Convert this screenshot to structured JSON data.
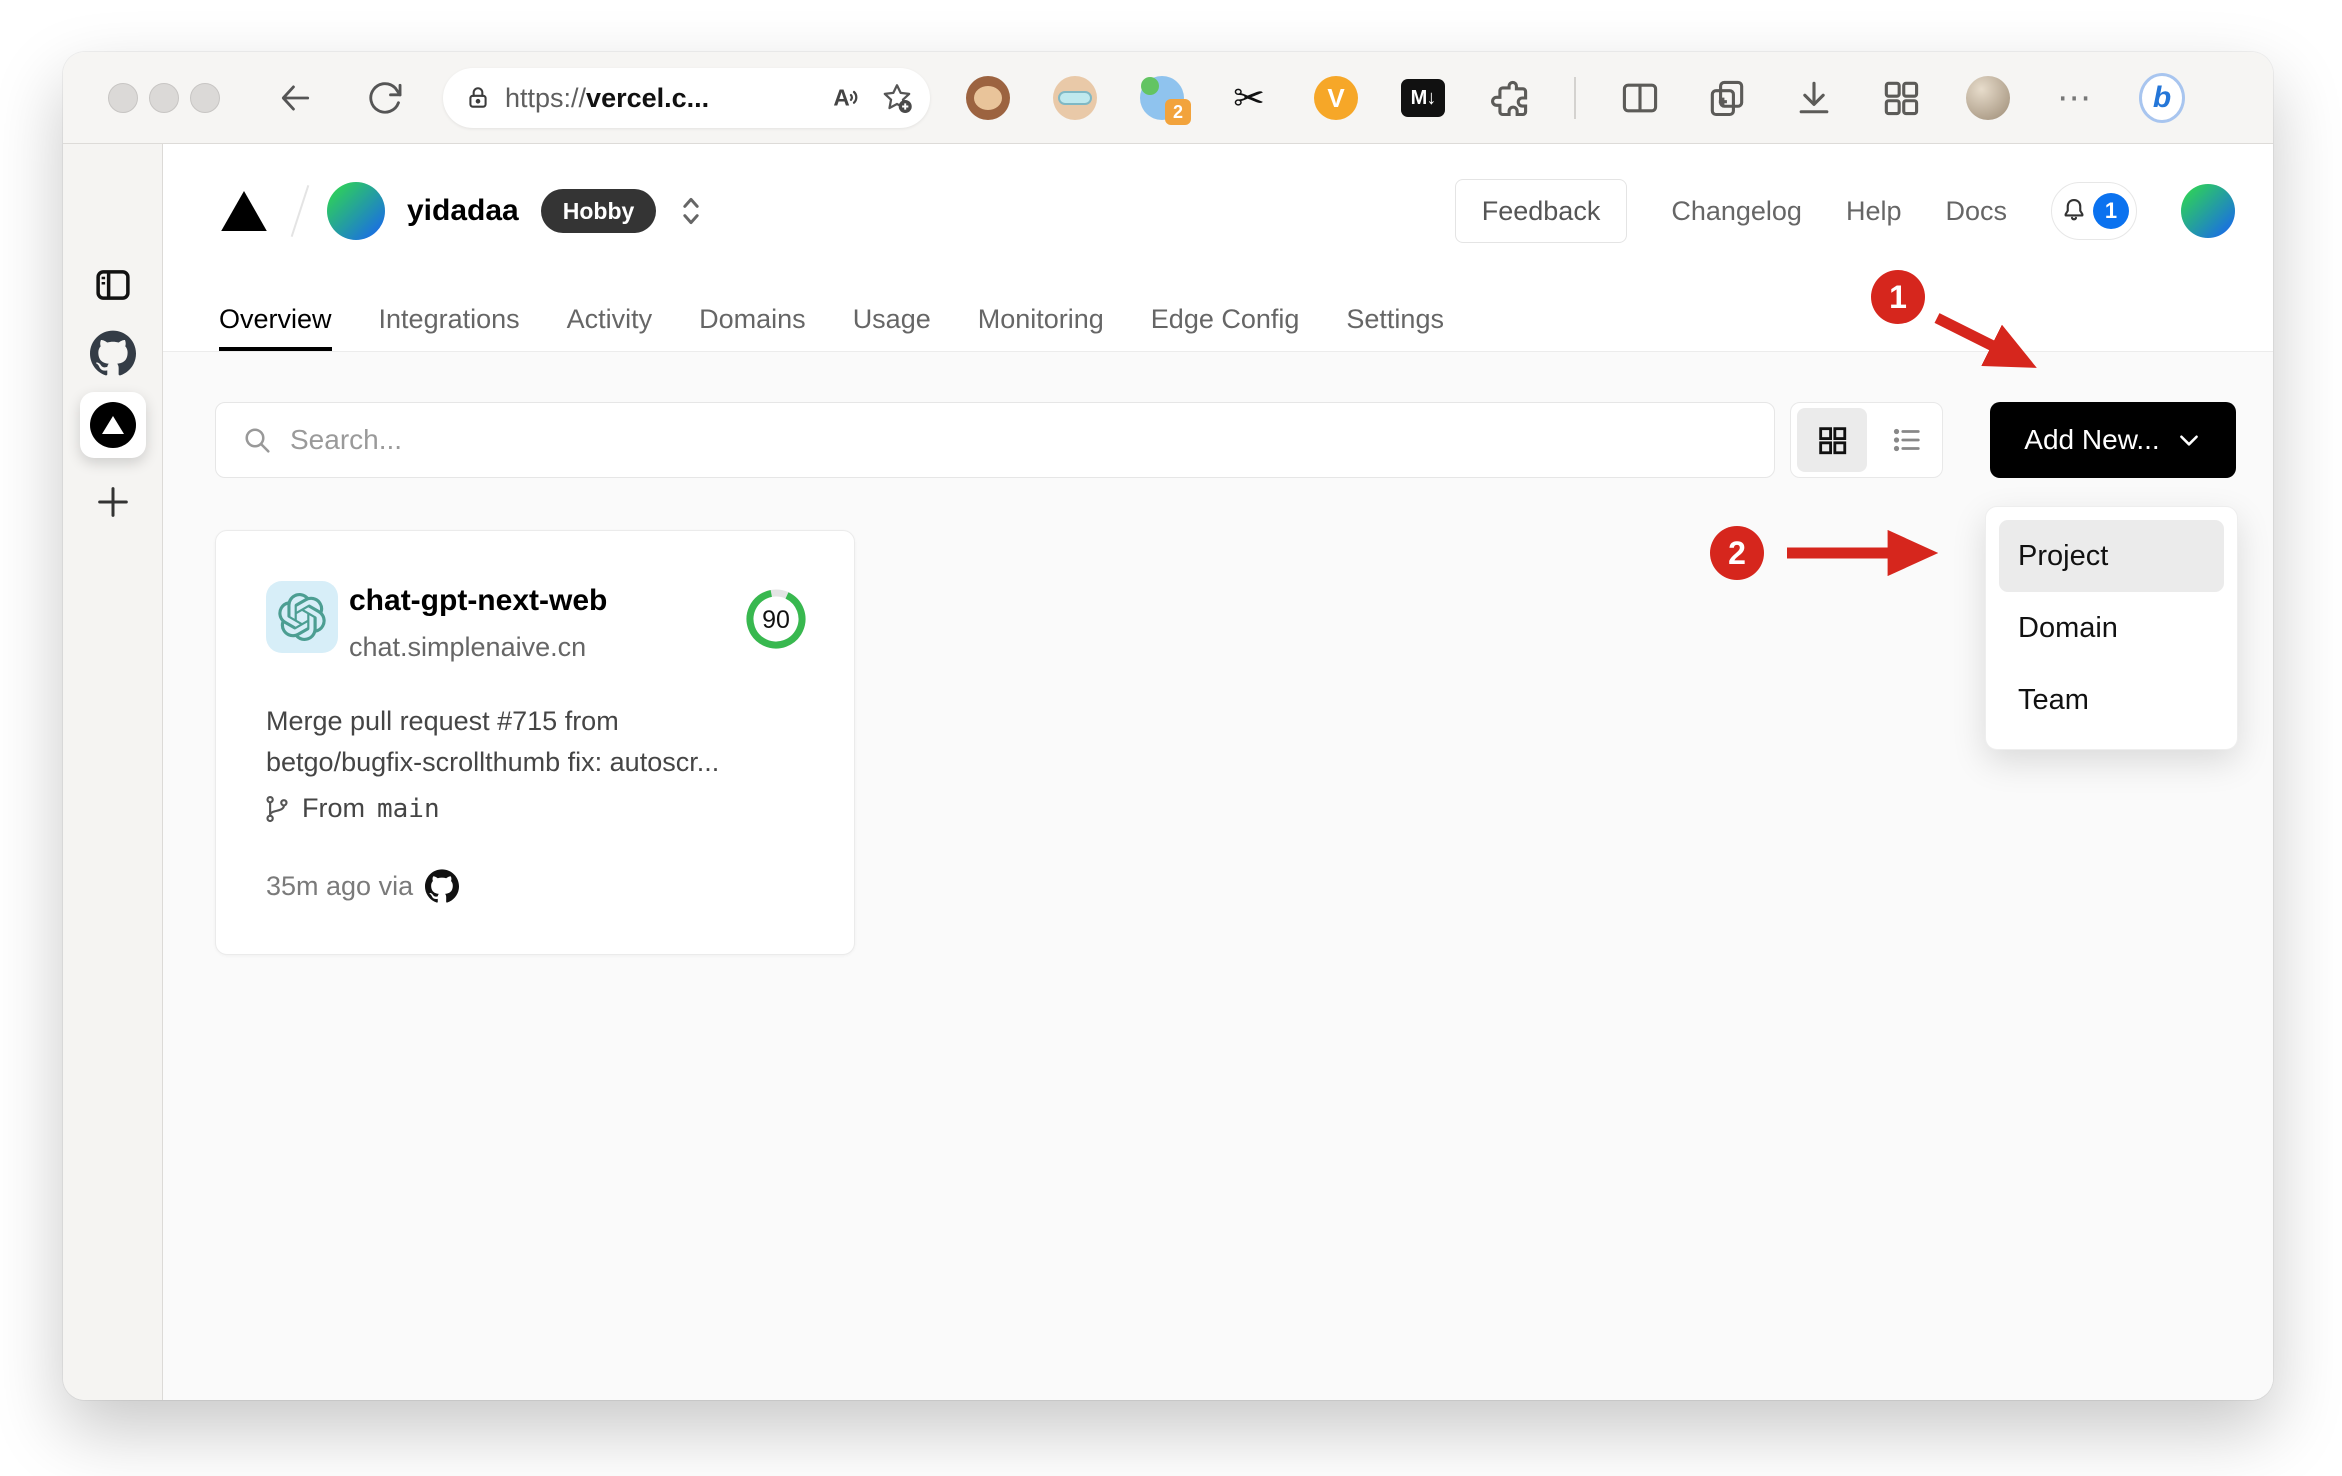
{
  "browser": {
    "url_scheme": "https://",
    "url_host": "vercel.c...",
    "extensions_badge_count": "2",
    "v_extension_label": "V",
    "markdown_extension_label": "M↓",
    "more_label": "⋯",
    "bing_label": "b"
  },
  "vercel": {
    "team_name": "yidadaa",
    "plan_badge": "Hobby",
    "feedback_label": "Feedback",
    "nav_links": [
      {
        "label": "Changelog"
      },
      {
        "label": "Help"
      },
      {
        "label": "Docs"
      }
    ],
    "notification_count": "1",
    "tabs": [
      {
        "label": "Overview",
        "active": true
      },
      {
        "label": "Integrations",
        "active": false
      },
      {
        "label": "Activity",
        "active": false
      },
      {
        "label": "Domains",
        "active": false
      },
      {
        "label": "Usage",
        "active": false
      },
      {
        "label": "Monitoring",
        "active": false
      },
      {
        "label": "Edge Config",
        "active": false
      },
      {
        "label": "Settings",
        "active": false
      }
    ],
    "search_placeholder": "Search...",
    "add_new_label": "Add New...",
    "dropdown": {
      "items": [
        {
          "label": "Project",
          "highlighted": true
        },
        {
          "label": "Domain",
          "highlighted": false
        },
        {
          "label": "Team",
          "highlighted": false
        }
      ]
    },
    "project_card": {
      "name": "chat-gpt-next-web",
      "domain": "chat.simplenaive.cn",
      "score": 90,
      "commit_line1": "Merge pull request #715 from",
      "commit_line2": "betgo/bugfix-scrollthumb fix: autoscr...",
      "branch_label": "From",
      "branch_name": "main",
      "deployed_info": "35m ago via"
    }
  },
  "annotations": {
    "step1": "1",
    "step2": "2"
  },
  "colors": {
    "annotation_red": "#d6261d",
    "ring_green": "#38b84f",
    "notification_blue": "#0b72ef",
    "add_new_black": "#000000",
    "avatar_gradient_start": "#2fd158",
    "avatar_gradient_end": "#1a6de5",
    "content_bg": "#fafafa"
  }
}
